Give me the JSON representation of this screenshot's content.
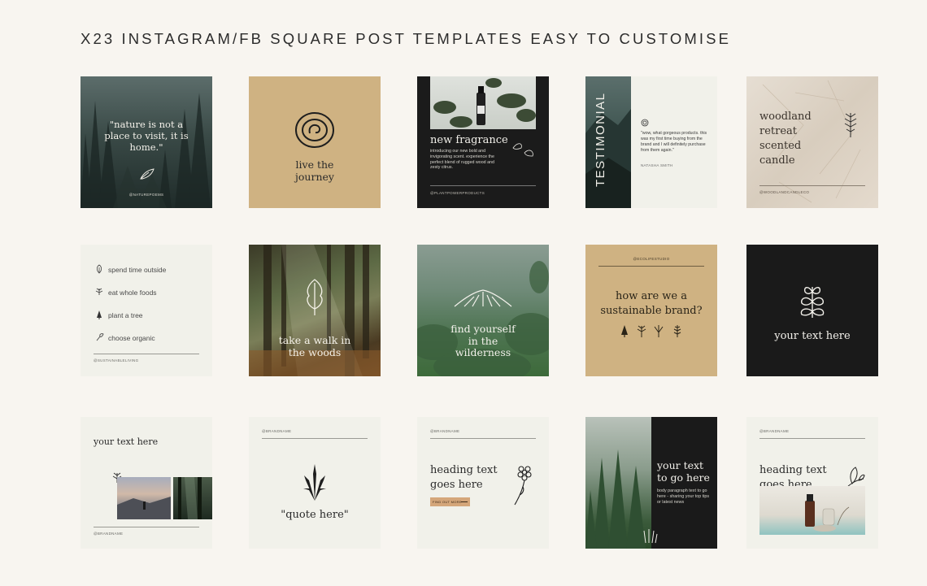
{
  "title": "X23 INSTAGRAM/FB SQUARE POST TEMPLATES EASY TO CUSTOMISE",
  "colors": {
    "background": "#f8f5f0",
    "cream": "#f1f1ea",
    "tan": "#cfb282",
    "black": "#1a1a1a",
    "forest": "#2b3c34"
  },
  "cards": {
    "c1": {
      "quote": "\"nature is not a place to visit, it is home.\"",
      "handle": "@NATUREPOEMS",
      "icon": "leaf-icon"
    },
    "c2": {
      "text": "live the journey",
      "icon": "spiral-icon"
    },
    "c3": {
      "heading": "new fragrance",
      "body": "introducing our new bold and invigorating scent. experience the perfect blend of rugged wood and zesty citrus.",
      "handle": "@PLANTPOWERPRODUCTS"
    },
    "c4": {
      "label": "TESTIMONIAL",
      "quote": "\"wow, what gorgeous products. this was my first time buying from the brand and I will definitely purchase from them again.\"",
      "author": "NATASHA SMITH"
    },
    "c5": {
      "text": "woodland retreat scented candle",
      "handle": "@WOODLANDCANDLECO"
    },
    "c6": {
      "items": [
        "spend time outside",
        "eat whole foods",
        "plant a tree",
        "choose organic"
      ],
      "handle": "@SUSTAINABLELIVING"
    },
    "c7": {
      "text": "take a walk in the woods"
    },
    "c8": {
      "text": "find yourself in the wilderness"
    },
    "c9": {
      "handle": "@ECOLIFESTUDIO",
      "text": "how are we a sustainable brand?"
    },
    "c10": {
      "text": "your text here"
    },
    "c11": {
      "text": "your text here",
      "handle": "@BRANDNAME"
    },
    "c12": {
      "handle": "@BRANDNAME",
      "text": "\"quote here\""
    },
    "c13": {
      "handle": "@BRANDNAME",
      "heading": "heading text goes here",
      "button": "FIND OUT MORE"
    },
    "c14": {
      "heading": "your text to go here",
      "body": "body paragraph text to go here - sharing your top tips or latest news"
    },
    "c15": {
      "handle": "@BRANDNAME",
      "heading": "heading text goes here"
    }
  }
}
